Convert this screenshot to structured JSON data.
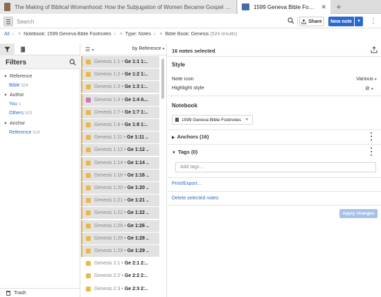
{
  "tabs": [
    {
      "title": "The Making of Biblical Womanhood: How the Subjugation of Women Became Gospel Truth",
      "active": false
    },
    {
      "title": "1599 Geneva Bible Footnotes",
      "active": true,
      "close": "✕"
    }
  ],
  "tab_add": "+",
  "toolbar": {
    "search_placeholder": "Search",
    "share_label": "Share",
    "new_note_label": "New note",
    "new_note_drop": "▼",
    "more": "⋮"
  },
  "breadcrumb": {
    "root": "All",
    "sep": "›",
    "x": "×",
    "notebook": "Notebook: 1599 Geneva Bible Footnotes",
    "type": "Type: Notes",
    "book": "Bible Book: Genesis",
    "count": "(524 results)"
  },
  "filters": {
    "title": "Filters",
    "groups": [
      {
        "label": "Reference",
        "items": [
          {
            "label": "Bible",
            "count": "524"
          }
        ]
      },
      {
        "label": "Author",
        "items": [
          {
            "label": "You",
            "count": "1"
          },
          {
            "label": "Others",
            "count": "523"
          }
        ]
      },
      {
        "label": "Anchor",
        "items": [
          {
            "label": "Reference",
            "count": "524"
          }
        ]
      }
    ],
    "trash": "Trash"
  },
  "notes_list": {
    "sort_label": "by Reference",
    "view_toggle": "☰",
    "rows": [
      {
        "ref": "Genesis 1:1",
        "head": "Ge 1:1 1:..",
        "icon": "sticky-note",
        "color": "#e7b94b",
        "selected": true
      },
      {
        "ref": "Genesis 1:2",
        "head": "Ge 1:2 1:..",
        "icon": "sticky-note",
        "color": "#e7b94b",
        "selected": true
      },
      {
        "ref": "Genesis 1:3",
        "head": "Ge 1:3 1:..",
        "icon": "sticky-note",
        "color": "#e7b94b",
        "selected": true
      },
      {
        "ref": "Genesis 1:4",
        "head": "Ge 1:4  A...",
        "icon": "sticky-note",
        "color": "#c678b0",
        "selected": true
      },
      {
        "ref": "Genesis 1:7",
        "head": "Ge 1:7 1:..",
        "icon": "sticky-note",
        "color": "#e7b94b",
        "selected": true
      },
      {
        "ref": "Genesis 1:8",
        "head": "Ge 1:8 1:..",
        "icon": "sticky-note",
        "color": "#e7b94b",
        "selected": true
      },
      {
        "ref": "Genesis 1:11",
        "head": "Ge 1:11 ..",
        "icon": "sticky-note",
        "color": "#e7b94b",
        "selected": true
      },
      {
        "ref": "Genesis 1:12",
        "head": "Ge 1:12 ..",
        "icon": "sticky-note",
        "color": "#e7b94b",
        "selected": true
      },
      {
        "ref": "Genesis 1:14",
        "head": "Ge 1:14 ..",
        "icon": "sticky-note",
        "color": "#e7b94b",
        "selected": true
      },
      {
        "ref": "Genesis 1:16",
        "head": "Ge 1:16 ..",
        "icon": "sticky-note",
        "color": "#e7b94b",
        "selected": true
      },
      {
        "ref": "Genesis 1:20",
        "head": "Ge 1:20 ..",
        "icon": "sticky-note",
        "color": "#e7b94b",
        "selected": true
      },
      {
        "ref": "Genesis 1:21",
        "head": "Ge 1:21 ..",
        "icon": "sticky-note",
        "color": "#e7b94b",
        "selected": true
      },
      {
        "ref": "Genesis 1:22",
        "head": "Ge 1:22 ..",
        "icon": "sticky-note",
        "color": "#e7b94b",
        "selected": true
      },
      {
        "ref": "Genesis 1:26",
        "head": "Ge 1:26 ..",
        "icon": "sticky-note",
        "color": "#e7b94b",
        "selected": true
      },
      {
        "ref": "Genesis 1:28",
        "head": "Ge 1:28 ..",
        "icon": "sticky-note",
        "color": "#e7b94b",
        "selected": true
      },
      {
        "ref": "Genesis 1:29",
        "head": "Ge 1:29 ..",
        "icon": "sticky-note",
        "color": "#e7b94b",
        "selected": true
      },
      {
        "ref": "Genesis 2:1",
        "head": "Ge 2:1 2:..",
        "icon": "sticky-note",
        "color": "#e7b94b",
        "selected": false
      },
      {
        "ref": "Genesis 2:2",
        "head": "Ge 2:2 2:..",
        "icon": "sticky-note",
        "color": "#e7b94b",
        "selected": false
      },
      {
        "ref": "Genesis 2:3",
        "head": "Ge 2:3 2:..",
        "icon": "sticky-note",
        "color": "#e7b94b",
        "selected": false
      }
    ]
  },
  "details": {
    "selected_count": "16 notes selected",
    "style_title": "Style",
    "note_icon_label": "Note icon",
    "note_icon_value": "Various",
    "highlight_label": "Highlight style",
    "highlight_value": "⊘",
    "notebook_title": "Notebook",
    "notebook_value": "1599 Geneva Bible Footnotes",
    "anchors": "Anchors (16)",
    "tags": "Tags (0)",
    "tags_placeholder": "Add tags…",
    "print_export": "Print/Export…",
    "delete_selected": "Delete selected notes",
    "apply": "Apply changes"
  },
  "colors": {
    "accent": "#2c69cf",
    "selection_bar": "#e7a84b",
    "apply_disabled": "#a4c1ea"
  }
}
